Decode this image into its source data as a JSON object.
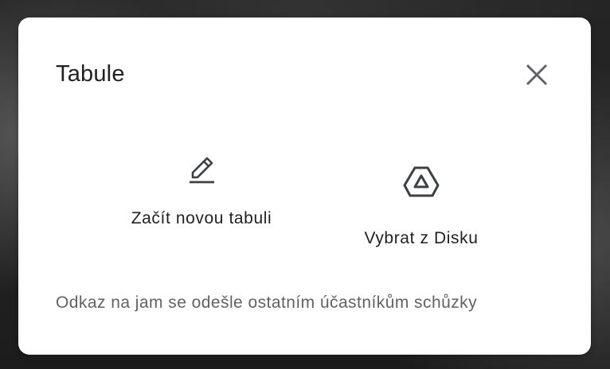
{
  "dialog": {
    "title": "Tabule",
    "close_icon": "close-icon",
    "options": [
      {
        "label": "Začít novou tabuli",
        "icon": "pencil-icon"
      },
      {
        "label": "Vybrat z Disku",
        "icon": "google-drive-icon"
      }
    ],
    "footer_note": "Odkaz na jam se odešle ostatním účastníkům schůzky"
  },
  "colors": {
    "dialog_background": "#ffffff",
    "title_text": "#202124",
    "secondary_text": "#5f6368",
    "icon": "#3c4043"
  }
}
